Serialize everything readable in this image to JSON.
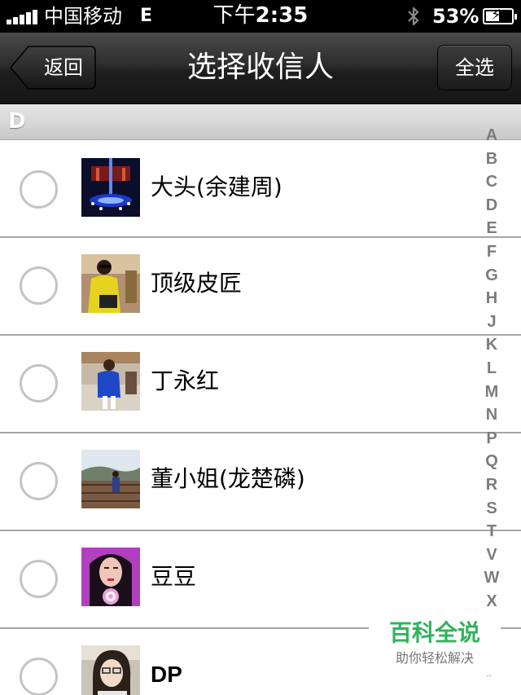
{
  "status_bar": {
    "carrier": "中国移动",
    "network": "E",
    "time_prefix": "下午",
    "time": "2:35",
    "battery": "53%",
    "battery_level": 0.53
  },
  "nav": {
    "back_label": "返回",
    "title": "选择收信人",
    "select_all_label": "全选"
  },
  "section": {
    "letter": "D"
  },
  "contacts": [
    {
      "name": "大头(余建周)"
    },
    {
      "name": "顶级皮匠"
    },
    {
      "name": "丁永红"
    },
    {
      "name": "董小姐(龙楚磷)"
    },
    {
      "name": "豆豆"
    },
    {
      "name": "DP"
    }
  ],
  "index": [
    "A",
    "B",
    "C",
    "D",
    "E",
    "F",
    "G",
    "H",
    "J",
    "K",
    "L",
    "M",
    "N",
    "P",
    "Q",
    "R",
    "S",
    "T",
    "V",
    "W",
    "X"
  ],
  "index_hash": "#",
  "watermark": {
    "title": "百科全说",
    "subtitle": "助你轻松解决"
  },
  "colors": {
    "nav_background": "#222222",
    "radio_border": "#c4c4c4",
    "watermark_green": "#30b35a"
  },
  "icons": [
    "signal-bars-icon",
    "bluetooth-icon",
    "battery-charging-icon",
    "back-arrow-icon"
  ]
}
